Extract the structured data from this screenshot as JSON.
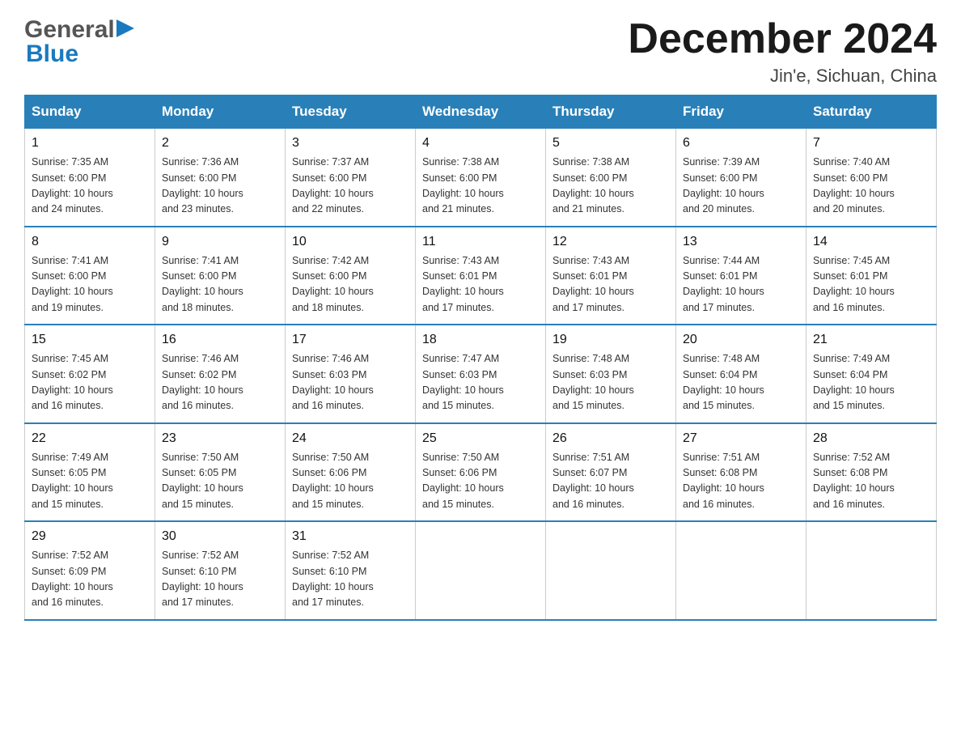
{
  "logo": {
    "general": "General",
    "blue": "Blue",
    "arrow_color": "#1a7abf"
  },
  "header": {
    "month_year": "December 2024",
    "location": "Jin'e, Sichuan, China"
  },
  "weekdays": [
    "Sunday",
    "Monday",
    "Tuesday",
    "Wednesday",
    "Thursday",
    "Friday",
    "Saturday"
  ],
  "weeks": [
    [
      {
        "day": "1",
        "sunrise": "Sunrise: 7:35 AM",
        "sunset": "Sunset: 6:00 PM",
        "daylight": "Daylight: 10 hours",
        "daylight2": "and 24 minutes."
      },
      {
        "day": "2",
        "sunrise": "Sunrise: 7:36 AM",
        "sunset": "Sunset: 6:00 PM",
        "daylight": "Daylight: 10 hours",
        "daylight2": "and 23 minutes."
      },
      {
        "day": "3",
        "sunrise": "Sunrise: 7:37 AM",
        "sunset": "Sunset: 6:00 PM",
        "daylight": "Daylight: 10 hours",
        "daylight2": "and 22 minutes."
      },
      {
        "day": "4",
        "sunrise": "Sunrise: 7:38 AM",
        "sunset": "Sunset: 6:00 PM",
        "daylight": "Daylight: 10 hours",
        "daylight2": "and 21 minutes."
      },
      {
        "day": "5",
        "sunrise": "Sunrise: 7:38 AM",
        "sunset": "Sunset: 6:00 PM",
        "daylight": "Daylight: 10 hours",
        "daylight2": "and 21 minutes."
      },
      {
        "day": "6",
        "sunrise": "Sunrise: 7:39 AM",
        "sunset": "Sunset: 6:00 PM",
        "daylight": "Daylight: 10 hours",
        "daylight2": "and 20 minutes."
      },
      {
        "day": "7",
        "sunrise": "Sunrise: 7:40 AM",
        "sunset": "Sunset: 6:00 PM",
        "daylight": "Daylight: 10 hours",
        "daylight2": "and 20 minutes."
      }
    ],
    [
      {
        "day": "8",
        "sunrise": "Sunrise: 7:41 AM",
        "sunset": "Sunset: 6:00 PM",
        "daylight": "Daylight: 10 hours",
        "daylight2": "and 19 minutes."
      },
      {
        "day": "9",
        "sunrise": "Sunrise: 7:41 AM",
        "sunset": "Sunset: 6:00 PM",
        "daylight": "Daylight: 10 hours",
        "daylight2": "and 18 minutes."
      },
      {
        "day": "10",
        "sunrise": "Sunrise: 7:42 AM",
        "sunset": "Sunset: 6:00 PM",
        "daylight": "Daylight: 10 hours",
        "daylight2": "and 18 minutes."
      },
      {
        "day": "11",
        "sunrise": "Sunrise: 7:43 AM",
        "sunset": "Sunset: 6:01 PM",
        "daylight": "Daylight: 10 hours",
        "daylight2": "and 17 minutes."
      },
      {
        "day": "12",
        "sunrise": "Sunrise: 7:43 AM",
        "sunset": "Sunset: 6:01 PM",
        "daylight": "Daylight: 10 hours",
        "daylight2": "and 17 minutes."
      },
      {
        "day": "13",
        "sunrise": "Sunrise: 7:44 AM",
        "sunset": "Sunset: 6:01 PM",
        "daylight": "Daylight: 10 hours",
        "daylight2": "and 17 minutes."
      },
      {
        "day": "14",
        "sunrise": "Sunrise: 7:45 AM",
        "sunset": "Sunset: 6:01 PM",
        "daylight": "Daylight: 10 hours",
        "daylight2": "and 16 minutes."
      }
    ],
    [
      {
        "day": "15",
        "sunrise": "Sunrise: 7:45 AM",
        "sunset": "Sunset: 6:02 PM",
        "daylight": "Daylight: 10 hours",
        "daylight2": "and 16 minutes."
      },
      {
        "day": "16",
        "sunrise": "Sunrise: 7:46 AM",
        "sunset": "Sunset: 6:02 PM",
        "daylight": "Daylight: 10 hours",
        "daylight2": "and 16 minutes."
      },
      {
        "day": "17",
        "sunrise": "Sunrise: 7:46 AM",
        "sunset": "Sunset: 6:03 PM",
        "daylight": "Daylight: 10 hours",
        "daylight2": "and 16 minutes."
      },
      {
        "day": "18",
        "sunrise": "Sunrise: 7:47 AM",
        "sunset": "Sunset: 6:03 PM",
        "daylight": "Daylight: 10 hours",
        "daylight2": "and 15 minutes."
      },
      {
        "day": "19",
        "sunrise": "Sunrise: 7:48 AM",
        "sunset": "Sunset: 6:03 PM",
        "daylight": "Daylight: 10 hours",
        "daylight2": "and 15 minutes."
      },
      {
        "day": "20",
        "sunrise": "Sunrise: 7:48 AM",
        "sunset": "Sunset: 6:04 PM",
        "daylight": "Daylight: 10 hours",
        "daylight2": "and 15 minutes."
      },
      {
        "day": "21",
        "sunrise": "Sunrise: 7:49 AM",
        "sunset": "Sunset: 6:04 PM",
        "daylight": "Daylight: 10 hours",
        "daylight2": "and 15 minutes."
      }
    ],
    [
      {
        "day": "22",
        "sunrise": "Sunrise: 7:49 AM",
        "sunset": "Sunset: 6:05 PM",
        "daylight": "Daylight: 10 hours",
        "daylight2": "and 15 minutes."
      },
      {
        "day": "23",
        "sunrise": "Sunrise: 7:50 AM",
        "sunset": "Sunset: 6:05 PM",
        "daylight": "Daylight: 10 hours",
        "daylight2": "and 15 minutes."
      },
      {
        "day": "24",
        "sunrise": "Sunrise: 7:50 AM",
        "sunset": "Sunset: 6:06 PM",
        "daylight": "Daylight: 10 hours",
        "daylight2": "and 15 minutes."
      },
      {
        "day": "25",
        "sunrise": "Sunrise: 7:50 AM",
        "sunset": "Sunset: 6:06 PM",
        "daylight": "Daylight: 10 hours",
        "daylight2": "and 15 minutes."
      },
      {
        "day": "26",
        "sunrise": "Sunrise: 7:51 AM",
        "sunset": "Sunset: 6:07 PM",
        "daylight": "Daylight: 10 hours",
        "daylight2": "and 16 minutes."
      },
      {
        "day": "27",
        "sunrise": "Sunrise: 7:51 AM",
        "sunset": "Sunset: 6:08 PM",
        "daylight": "Daylight: 10 hours",
        "daylight2": "and 16 minutes."
      },
      {
        "day": "28",
        "sunrise": "Sunrise: 7:52 AM",
        "sunset": "Sunset: 6:08 PM",
        "daylight": "Daylight: 10 hours",
        "daylight2": "and 16 minutes."
      }
    ],
    [
      {
        "day": "29",
        "sunrise": "Sunrise: 7:52 AM",
        "sunset": "Sunset: 6:09 PM",
        "daylight": "Daylight: 10 hours",
        "daylight2": "and 16 minutes."
      },
      {
        "day": "30",
        "sunrise": "Sunrise: 7:52 AM",
        "sunset": "Sunset: 6:10 PM",
        "daylight": "Daylight: 10 hours",
        "daylight2": "and 17 minutes."
      },
      {
        "day": "31",
        "sunrise": "Sunrise: 7:52 AM",
        "sunset": "Sunset: 6:10 PM",
        "daylight": "Daylight: 10 hours",
        "daylight2": "and 17 minutes."
      },
      null,
      null,
      null,
      null
    ]
  ]
}
